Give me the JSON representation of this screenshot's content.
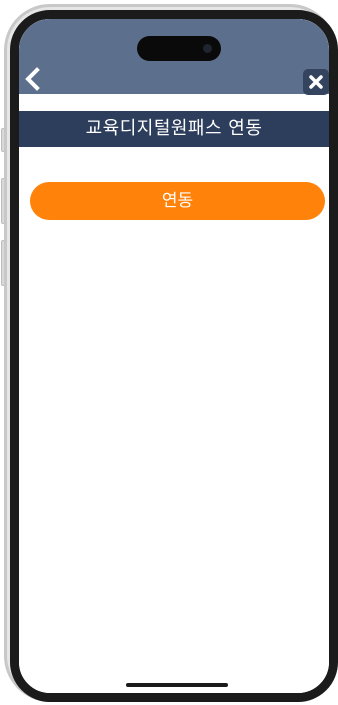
{
  "header": {
    "back_icon": "chevron-left-icon",
    "close_icon": "close-icon"
  },
  "title": "교육디지털원패스 연동",
  "actions": {
    "link_button_label": "연동"
  },
  "colors": {
    "header_bg": "#5c6f8d",
    "title_bar_bg": "#2d3e5c",
    "close_button_bg": "#34445f",
    "link_button_bg": "#ff820a"
  }
}
